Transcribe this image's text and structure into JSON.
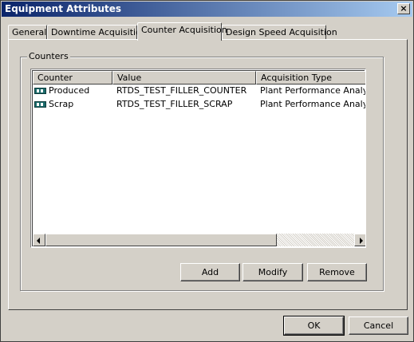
{
  "window": {
    "title": "Equipment Attributes",
    "close_label": "×"
  },
  "tabs": [
    {
      "label": "General"
    },
    {
      "label": "Downtime Acquisition"
    },
    {
      "label": "Counter Acquisition"
    },
    {
      "label": "Design Speed Acquisition"
    }
  ],
  "group": {
    "label": "Counters"
  },
  "table": {
    "columns": [
      "Counter",
      "Value",
      "Acquisition Type"
    ],
    "rows": [
      {
        "counter": "Produced",
        "value": "RTDS_TEST_FILLER_COUNTER",
        "type": "Plant Performance Analyzer"
      },
      {
        "counter": "Scrap",
        "value": "RTDS_TEST_FILLER_SCRAP",
        "type": "Plant Performance Analyzer"
      }
    ]
  },
  "buttons": {
    "add": "Add",
    "modify": "Modify",
    "remove": "Remove",
    "ok": "OK",
    "cancel": "Cancel"
  },
  "colors": {
    "title_start": "#0a246a",
    "title_end": "#a6caf0",
    "face": "#d4d0c8",
    "counter_icon": "#1a6b6b"
  }
}
